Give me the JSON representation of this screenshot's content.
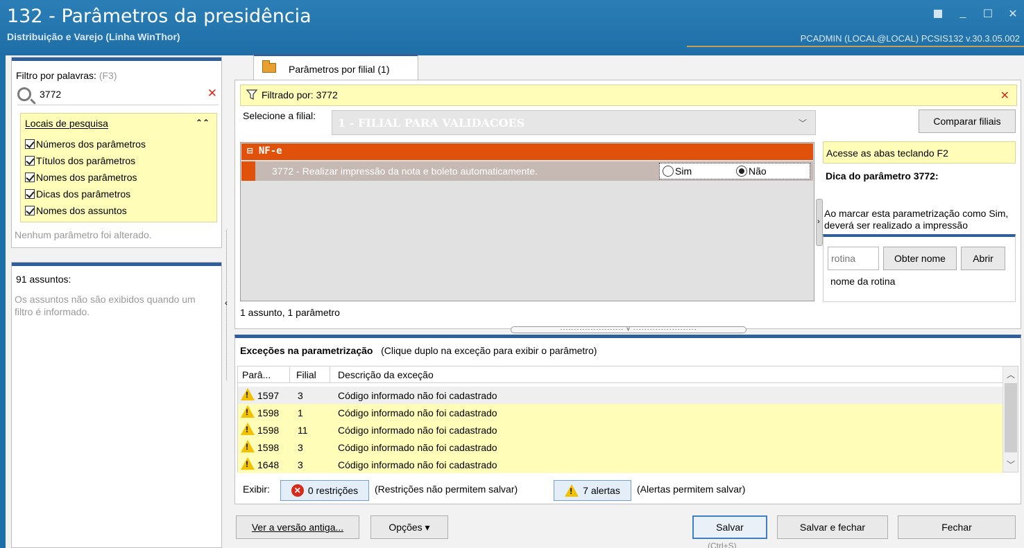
{
  "window": {
    "title": "132 - Parâmetros da presidência",
    "subtitle": "Distribuição e Varejo (Linha WinThor)",
    "user_info": "PCADMIN (LOCAL@LOCAL)   PCSIS132  v.30.3.05.002",
    "controls": [
      "restore-icon",
      "minimize-icon",
      "maximize-icon",
      "close-icon"
    ]
  },
  "filter": {
    "label": "Filtro por palavras:",
    "shortcut": "(F3)",
    "value": "3772",
    "locais": {
      "title": "Locais de pesquisa",
      "options": [
        {
          "label": "Números dos parâmetros",
          "checked": true
        },
        {
          "label": "Títulos dos parâmetros",
          "checked": true
        },
        {
          "label": "Nomes dos parâmetros",
          "checked": true
        },
        {
          "label": "Dicas dos parâmetros",
          "checked": true
        },
        {
          "label": "Nomes dos assuntos",
          "checked": true
        }
      ]
    },
    "status": "Nenhum parâmetro foi alterado."
  },
  "assuntos": {
    "title": "91 assuntos:",
    "message": "Os assuntos não são exibidos quando um filtro é informado."
  },
  "tab": {
    "label": "Parâmetros por filial  (1)"
  },
  "filterbar": {
    "text": "Filtrado por: 3772"
  },
  "filial": {
    "label": "Selecione a filial:",
    "value": "1 - FILIAL PARA VALIDACOES",
    "compare_button": "Comparar filiais"
  },
  "group": {
    "name": "NF-e"
  },
  "param": {
    "text": "3772 - Realizar impressão da nota e boleto automaticamente.",
    "options": [
      {
        "label": "Sim",
        "selected": false
      },
      {
        "label": "Não",
        "selected": true
      }
    ]
  },
  "tip": {
    "hint": "Acesse as abas teclando F2",
    "title": "Dica do parâmetro 3772:",
    "text": "Ao marcar esta parametrização como Sim, deverá ser realizado a impressão"
  },
  "rotina": {
    "placeholder": "rotina",
    "obter_button": "Obter nome",
    "abrir_button": "Abrir",
    "name_label": "nome da rotina"
  },
  "count_status": "1 assunto, 1 parâmetro",
  "exceptions": {
    "title": "Exceções na parametrização",
    "subtitle": "(Clique duplo na exceção para exibir o parâmetro)",
    "columns": [
      "Parâ...",
      "Filial",
      "Descrição da exceção"
    ],
    "rows": [
      {
        "param": "1597",
        "filial": "3",
        "desc": "Código informado não foi cadastrado"
      },
      {
        "param": "1598",
        "filial": "1",
        "desc": "Código informado não foi cadastrado"
      },
      {
        "param": "1598",
        "filial": "11",
        "desc": "Código informado não foi cadastrado"
      },
      {
        "param": "1598",
        "filial": "3",
        "desc": "Código informado não foi cadastrado"
      },
      {
        "param": "1648",
        "filial": "3",
        "desc": "Código informado não foi cadastrado"
      }
    ]
  },
  "exibir": {
    "label": "Exibir:",
    "restricoes_button": "0 restrições",
    "restricoes_note": "(Restrições não permitem salvar)",
    "alertas_button": "7 alertas",
    "alertas_note": "(Alertas permitem salvar)"
  },
  "footer": {
    "versao_button": "Ver a versão antiga...",
    "opcoes_button": "Opções ▾",
    "salvar_button": "Salvar",
    "salvar_shortcut": "(Ctrl+S)",
    "salvar_fechar_button": "Salvar e fechar",
    "fechar_button": "Fechar"
  }
}
